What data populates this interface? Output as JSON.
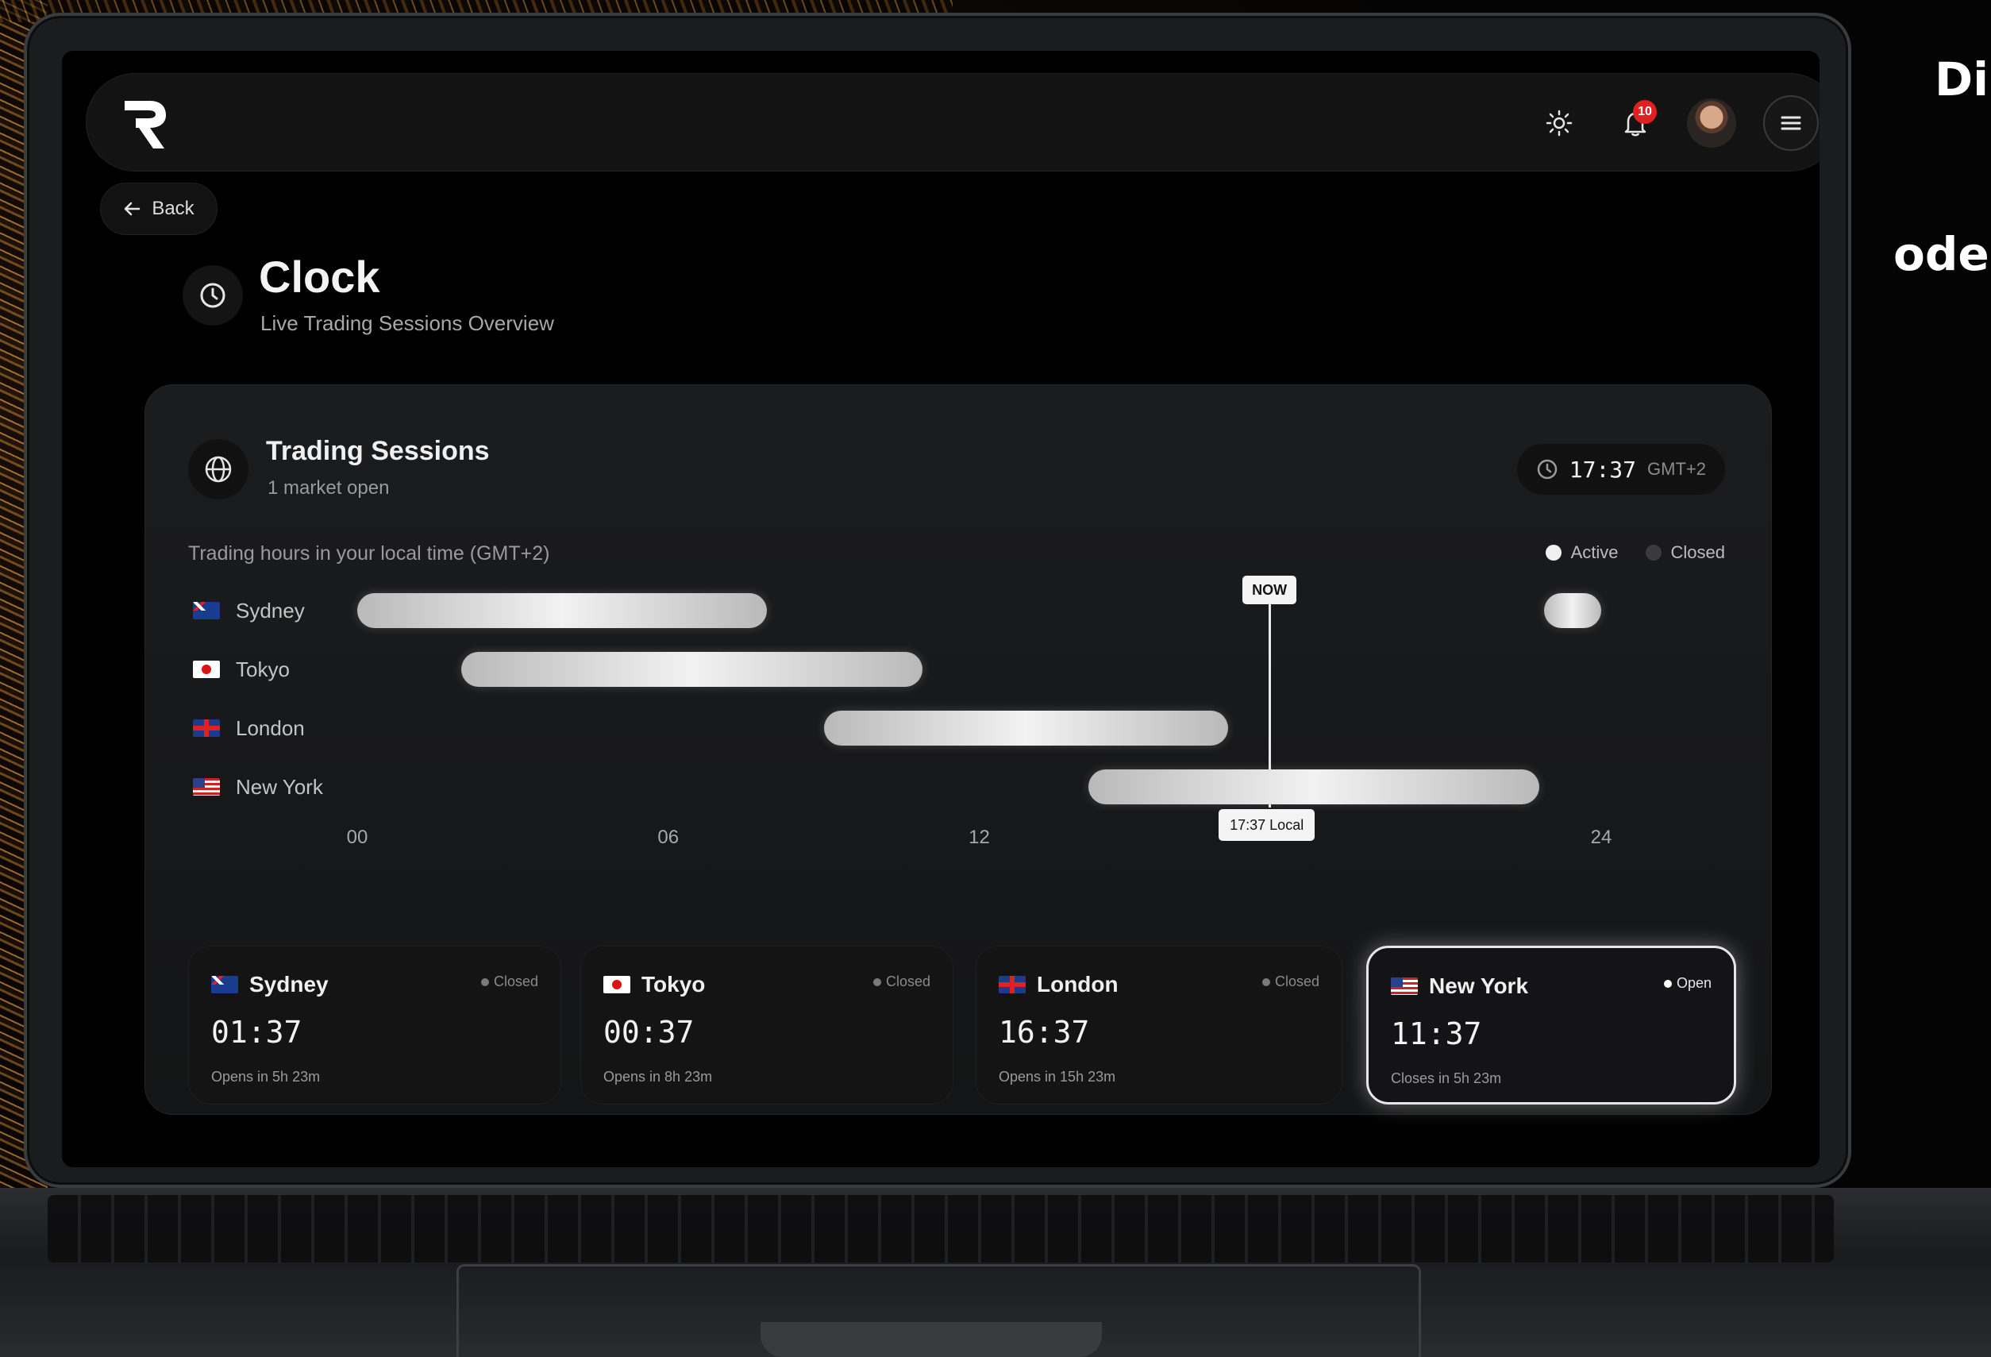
{
  "side_text": {
    "line1": "Di",
    "line2": "oder"
  },
  "nav": {
    "notification_count": "10",
    "icons": [
      "theme-toggle-icon",
      "bell-icon",
      "avatar",
      "menu-icon"
    ]
  },
  "back": {
    "label": "Back"
  },
  "page": {
    "title": "Clock",
    "subtitle": "Live Trading Sessions Overview"
  },
  "sessions_card": {
    "title": "Trading Sessions",
    "subtitle": "1 market open",
    "current_time": "17:37",
    "timezone": "GMT+2",
    "hours_label": "Trading hours in your local time (GMT+2)",
    "legend": {
      "active": "Active",
      "closed": "Closed"
    },
    "now_label": "NOW",
    "local_label": "17:37 Local",
    "ticks": [
      "00",
      "06",
      "12",
      "24"
    ]
  },
  "chart_data": {
    "type": "timeline",
    "x_range": [
      0,
      24
    ],
    "now": 17.6,
    "rows": [
      {
        "name": "Sydney",
        "ranges": [
          [
            0,
            7.9
          ],
          [
            22.9,
            24
          ]
        ]
      },
      {
        "name": "Tokyo",
        "ranges": [
          [
            2,
            10.9
          ]
        ]
      },
      {
        "name": "London",
        "ranges": [
          [
            9,
            16.8
          ]
        ]
      },
      {
        "name": "New York",
        "ranges": [
          [
            14.1,
            22.8
          ]
        ]
      }
    ]
  },
  "markets": [
    {
      "name": "Sydney",
      "flag": "au",
      "status": "Closed",
      "time": "01:37",
      "note": "Opens in 5h 23m",
      "active": false
    },
    {
      "name": "Tokyo",
      "flag": "jp",
      "status": "Closed",
      "time": "00:37",
      "note": "Opens in 8h 23m",
      "active": false
    },
    {
      "name": "London",
      "flag": "uk",
      "status": "Closed",
      "time": "16:37",
      "note": "Opens in 15h 23m",
      "active": false
    },
    {
      "name": "New York",
      "flag": "us",
      "status": "Open",
      "time": "11:37",
      "note": "Closes in 5h 23m",
      "active": true
    }
  ],
  "colors": {
    "accent": "#f2f2f2",
    "badge": "#e02020",
    "background": "#000000"
  }
}
